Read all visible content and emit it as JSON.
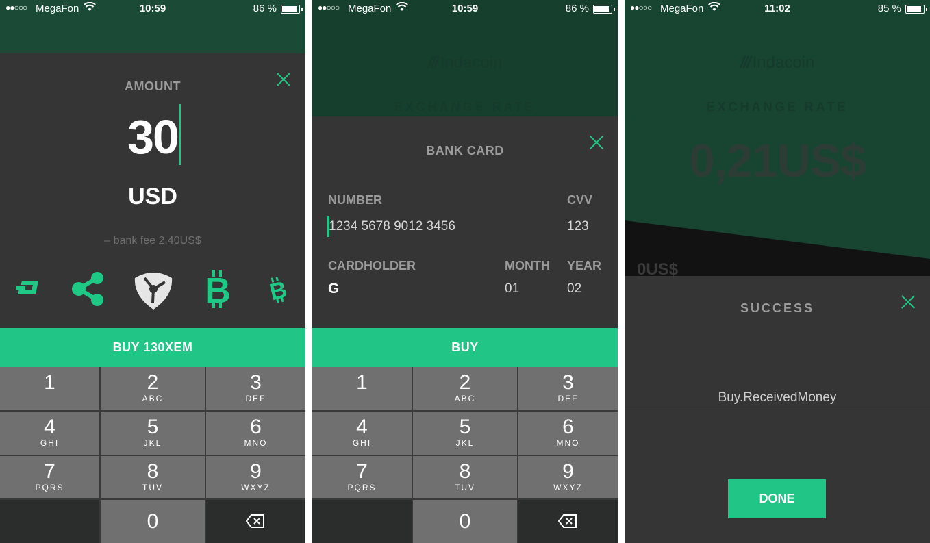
{
  "screens": [
    {
      "status": {
        "carrier": "MegaFon",
        "time": "10:59",
        "battery": "86 %",
        "battery_level": 0.86
      },
      "amount_label": "AMOUNT",
      "amount_value": "30",
      "currency": "USD",
      "fee": "– bank fee 2,40US$",
      "coins": [
        "dash-icon",
        "ripple-icon",
        "nem-icon",
        "bitcoin-icon",
        "bitcoin-cash-icon"
      ],
      "buy_label": "BUY 130XEM"
    },
    {
      "status": {
        "carrier": "MegaFon",
        "time": "10:59",
        "battery": "86 %",
        "battery_level": 0.86
      },
      "logo": "Indacoin",
      "rate_label": "EXCHANGE RATE",
      "title": "BANK CARD",
      "number_label": "NUMBER",
      "number_value": "1234 5678 9012 3456",
      "cvv_label": "CVV",
      "cvv_value": "123",
      "cardholder_label": "CARDHOLDER",
      "cardholder_value": "G",
      "month_label": "MONTH",
      "month_value": "01",
      "year_label": "YEAR",
      "year_value": "02",
      "buy_label": "BUY"
    },
    {
      "status": {
        "carrier": "MegaFon",
        "time": "11:02",
        "battery": "85 %",
        "battery_level": 0.85
      },
      "logo": "Indacoin",
      "rate_label": "EXCHANGE RATE",
      "rate_value": "0,21US$",
      "partial_text": "0US$",
      "title": "SUCCESS",
      "message": "Buy.ReceivedMoney",
      "done_label": "DONE"
    }
  ],
  "keypad": {
    "keys": [
      {
        "digit": "1",
        "letters": ""
      },
      {
        "digit": "2",
        "letters": "ABC"
      },
      {
        "digit": "3",
        "letters": "DEF"
      },
      {
        "digit": "4",
        "letters": "GHI"
      },
      {
        "digit": "5",
        "letters": "JKL"
      },
      {
        "digit": "6",
        "letters": "MNO"
      },
      {
        "digit": "7",
        "letters": "PQRS"
      },
      {
        "digit": "8",
        "letters": "TUV"
      },
      {
        "digit": "9",
        "letters": "WXYZ"
      },
      {
        "digit": "0",
        "letters": ""
      }
    ]
  },
  "colors": {
    "accent": "#21c585",
    "sheet": "#353535",
    "header": "#1b4b37"
  }
}
